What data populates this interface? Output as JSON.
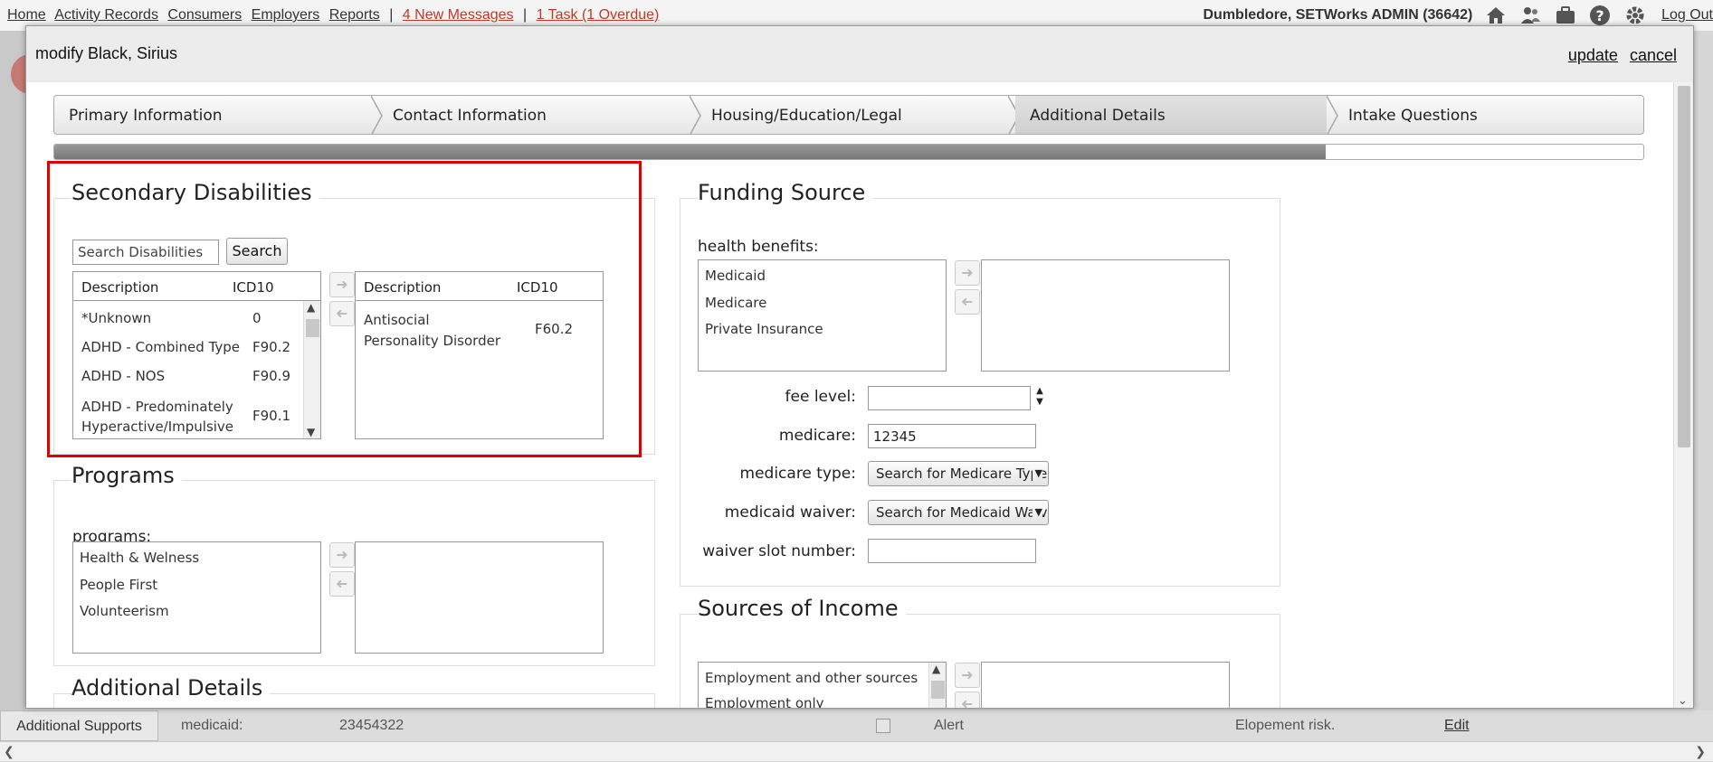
{
  "topnav": {
    "links": [
      "Home",
      "Activity Records",
      "Consumers",
      "Employers",
      "Reports"
    ],
    "separator": "|",
    "messages": "4 New Messages",
    "tasks": "1 Task (1 Overdue)",
    "user": "Dumbledore, SETWorks ADMIN  (36642)",
    "logout": "Log Out",
    "icons": [
      "home-icon",
      "users-icon",
      "briefcase-icon",
      "help-icon",
      "gear-icon"
    ]
  },
  "modal": {
    "title": "modify Black, Sirius",
    "update": "update",
    "cancel": "cancel"
  },
  "wizard": {
    "steps": [
      "Primary Information",
      "Contact Information",
      "Housing/Education/Legal",
      "Additional Details",
      "Intake Questions"
    ],
    "active_index": 3,
    "progress_fraction": 0.8
  },
  "secondary": {
    "title": "Secondary Disabilities",
    "search_placeholder": "Search Disabilities",
    "search_button": "Search",
    "col_description": "Description",
    "col_icd": "ICD10",
    "available": [
      {
        "desc": "*Unknown",
        "code": "0"
      },
      {
        "desc": "ADHD - Combined Type",
        "code": "F90.2"
      },
      {
        "desc": "ADHD - NOS",
        "code": "F90.9"
      },
      {
        "desc": "ADHD - Predominately Hyperactive/Impulsive Type",
        "code": "F90.1"
      }
    ],
    "selected": [
      {
        "desc": "Antisocial Personality Disorder",
        "code": "F60.2"
      }
    ]
  },
  "programs": {
    "title": "Programs",
    "label": "programs:",
    "available": [
      "Health & Welness",
      "People First",
      "Volunteerism"
    ],
    "selected": []
  },
  "additional": {
    "title": "Additional Details"
  },
  "funding": {
    "title": "Funding Source",
    "health_label": "health benefits:",
    "available": [
      "Medicaid",
      "Medicare",
      "Private Insurance"
    ],
    "selected": [],
    "fee_label": "fee level:",
    "fee_value": "",
    "medicare_label": "medicare:",
    "medicare_value": "12345",
    "medicare_type_label": "medicare type:",
    "medicare_type_value": "Search for Medicare Type",
    "medicaid_waiver_label": "medicaid waiver:",
    "medicaid_waiver_value": "Search for Medicaid Waiver",
    "waiver_slot_label": "waiver slot number:",
    "waiver_slot_value": ""
  },
  "income": {
    "title": "Sources of Income",
    "available": [
      "Employment and other sources",
      "Employment only"
    ],
    "selected": []
  },
  "background": {
    "tab": "Additional Supports",
    "medicaid_label": "medicaid:",
    "medicaid_value": "23454322",
    "alert": "Alert",
    "elopement": "Elopement risk.",
    "edit": "Edit"
  },
  "colors": {
    "highlight": "#e00000",
    "message_red": "#c0392b"
  }
}
